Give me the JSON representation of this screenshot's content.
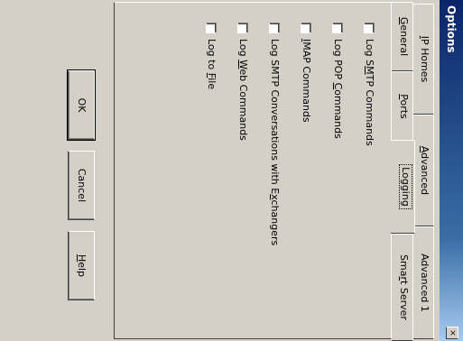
{
  "window": {
    "title": "Options",
    "close_glyph": "×"
  },
  "tabs": {
    "row_back": [
      {
        "pre": "",
        "mn": "I",
        "post": "P Homes"
      },
      {
        "pre": "",
        "mn": "A",
        "post": "dvanced"
      },
      {
        "pre": "Advanced 1",
        "mn": "",
        "post": ""
      }
    ],
    "row_front": [
      {
        "pre": "",
        "mn": "G",
        "post": "eneral"
      },
      {
        "pre": "",
        "mn": "P",
        "post": "orts"
      },
      {
        "pre": "Logging",
        "mn": "",
        "post": ""
      },
      {
        "pre": "Sma",
        "mn": "r",
        "post": "t Server"
      }
    ],
    "active_tab": "Logging"
  },
  "logging": {
    "options": [
      {
        "pre": "Log S",
        "mn": "M",
        "post": "TP Commands",
        "checked": false
      },
      {
        "pre": "Log POP ",
        "mn": "C",
        "post": "ommands",
        "checked": false
      },
      {
        "pre": "",
        "mn": "I",
        "post": "MAP Commands",
        "checked": false
      },
      {
        "pre": "Log SMTP Conversations with E",
        "mn": "x",
        "post": "changers",
        "checked": false
      },
      {
        "pre": "Log ",
        "mn": "W",
        "post": "eb Commands",
        "checked": false
      },
      {
        "pre": "Log to ",
        "mn": "F",
        "post": "ile",
        "checked": false
      }
    ]
  },
  "buttons": {
    "ok": "OK",
    "cancel": "Cancel",
    "help_mn": "H",
    "help_post": "elp"
  }
}
